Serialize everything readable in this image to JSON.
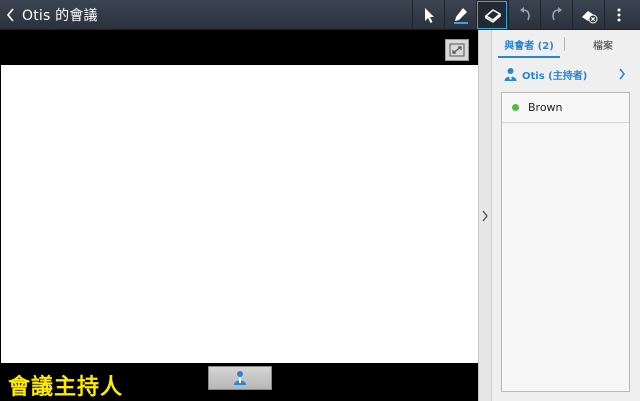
{
  "header": {
    "title": "Otis 的會議"
  },
  "toolbar": {
    "tools": [
      {
        "name": "pointer-tool",
        "icon": "cursor-icon"
      },
      {
        "name": "pen-tool",
        "icon": "pen-icon"
      },
      {
        "name": "eraser-tool",
        "icon": "eraser-icon",
        "active": true
      },
      {
        "name": "undo-tool",
        "icon": "undo-icon"
      },
      {
        "name": "redo-tool",
        "icon": "redo-icon"
      },
      {
        "name": "clear-tool",
        "icon": "clear-all-icon"
      },
      {
        "name": "more-tool",
        "icon": "more-vertical-icon"
      }
    ],
    "accent": "#3da3e0"
  },
  "board": {
    "caption": "會議主持人"
  },
  "panel": {
    "tabs": [
      {
        "label": "與會者 (2)",
        "active": true
      },
      {
        "label": "檔案",
        "active": false
      }
    ],
    "host": {
      "label": "Otis (主持者)"
    },
    "participants": [
      {
        "name": "Brown",
        "status_color": "#4cc23a"
      }
    ],
    "accent": "#2a86d1"
  }
}
